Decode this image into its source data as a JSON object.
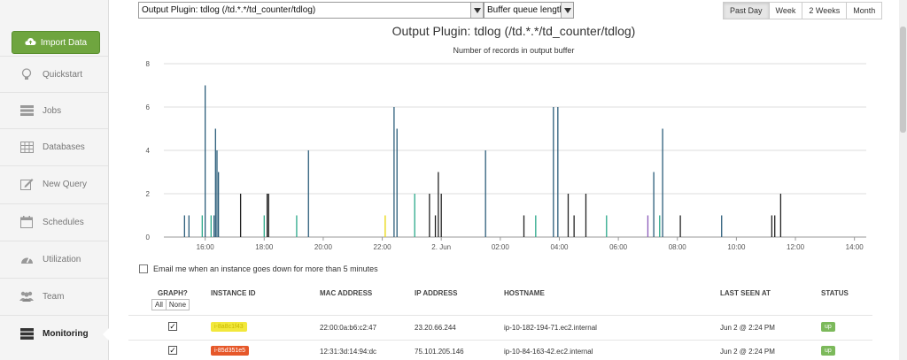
{
  "sidebar": {
    "import_label": "Import Data",
    "items": [
      {
        "label": "Quickstart",
        "icon": "lightbulb-icon"
      },
      {
        "label": "Jobs",
        "icon": "list-icon"
      },
      {
        "label": "Databases",
        "icon": "table-icon"
      },
      {
        "label": "New Query",
        "icon": "edit-icon"
      },
      {
        "label": "Schedules",
        "icon": "calendar-icon"
      },
      {
        "label": "Utilization",
        "icon": "gauge-icon"
      },
      {
        "label": "Team",
        "icon": "team-icon"
      },
      {
        "label": "Monitoring",
        "icon": "server-icon",
        "active": true
      }
    ]
  },
  "controls": {
    "plugin_select": "Output Plugin: tdlog (/td.*.*/td_counter/tdlog)",
    "metric_select": "Buffer queue length",
    "ranges": [
      "Past Day",
      "Week",
      "2 Weeks",
      "Month"
    ],
    "active_range": "Past Day"
  },
  "chart_data": {
    "type": "bar",
    "title": "Output Plugin: tdlog (/td.*.*/td_counter/tdlog)",
    "subtitle": "Number of records in output buffer",
    "ylim": [
      0,
      8
    ],
    "yticks": [
      0,
      2,
      4,
      6,
      8
    ],
    "xticks": [
      "16:00",
      "18:00",
      "20:00",
      "22:00",
      "2. Jun",
      "02:00",
      "04:00",
      "06:00",
      "08:00",
      "10:00",
      "12:00",
      "14:00"
    ],
    "xrange_hours": [
      14.6,
      38.4
    ],
    "grid": true,
    "series": [
      {
        "color": "#2b5d7a",
        "x": [
          15.3,
          15.45,
          16.0,
          16.3,
          16.35,
          16.4,
          16.45,
          19.5,
          22.4,
          22.5,
          25.5,
          27.8,
          27.95,
          31.2,
          31.5,
          33.5
        ],
        "values": [
          1,
          1,
          7,
          1,
          5,
          4,
          3,
          4,
          6,
          5,
          4,
          6,
          6,
          3,
          5,
          1
        ]
      },
      {
        "color": "#222222",
        "x": [
          17.2,
          18.1,
          18.15,
          23.6,
          23.8,
          23.9,
          24.0,
          26.8,
          28.3,
          28.5,
          28.9,
          32.1,
          35.2,
          35.3,
          35.5
        ],
        "values": [
          2,
          2,
          2,
          2,
          1,
          3,
          2,
          1,
          2,
          1,
          2,
          1,
          1,
          1,
          2
        ]
      },
      {
        "color": "#2aa889",
        "x": [
          15.9,
          16.2,
          18.0,
          19.1,
          23.1,
          27.2,
          29.6,
          31.4
        ],
        "values": [
          1,
          1,
          1,
          1,
          2,
          1,
          1,
          1
        ]
      },
      {
        "color": "#e8d60a",
        "x": [
          22.1
        ],
        "values": [
          1
        ]
      },
      {
        "color": "#8a5bb8",
        "x": [
          31.0
        ],
        "values": [
          1
        ]
      }
    ]
  },
  "email_label": "Email me when an instance goes down for more than 5 minutes",
  "table": {
    "headers": [
      "GRAPH?",
      "INSTANCE ID",
      "MAC ADDRESS",
      "IP ADDRESS",
      "HOSTNAME",
      "LAST SEEN AT",
      "STATUS"
    ],
    "all_label": "All",
    "none_label": "None",
    "rows": [
      {
        "checked": "✓",
        "instance": "i-8a8c1f43",
        "instance_color": "#f2e83c",
        "mac": "22:00:0a:b6:c2:47",
        "ip": "23.20.66.244",
        "hostname": "ip-10-182-194-71.ec2.internal",
        "last_seen": "Jun 2 @ 2:24 PM",
        "status": "up"
      },
      {
        "checked": "✓",
        "instance": "i-85d351e5",
        "instance_color": "#e6582a",
        "mac": "12:31:3d:14:94:dc",
        "ip": "75.101.205.146",
        "hostname": "ip-10-84-163-42.ec2.internal",
        "last_seen": "Jun 2 @ 2:24 PM",
        "status": "up"
      }
    ]
  }
}
